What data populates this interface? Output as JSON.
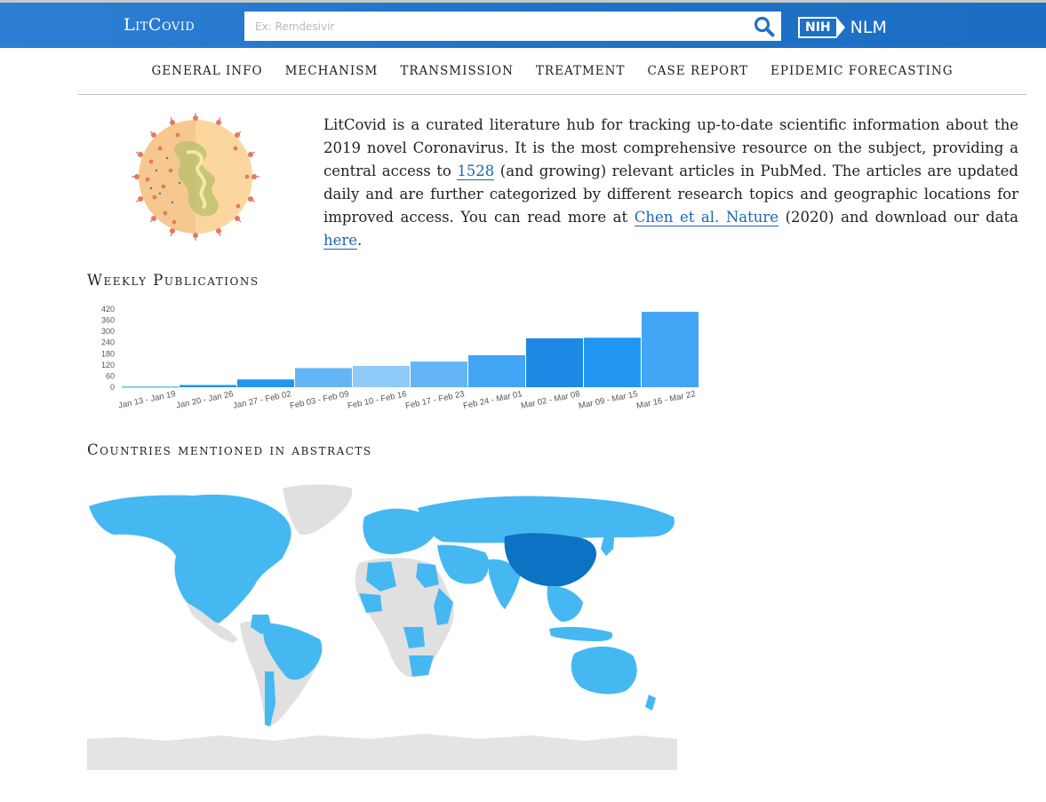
{
  "header": {
    "brand": "LitCovid",
    "search_placeholder": "Ex: Remdesivir",
    "search_icon": "search-icon",
    "nih_label": "NIH",
    "nlm_label": "NLM",
    "colors": {
      "bar": "#1f71c6",
      "accent": "#1a66b5"
    }
  },
  "nav": {
    "items": [
      "GENERAL INFO",
      "MECHANISM",
      "TRANSMISSION",
      "TREATMENT",
      "CASE REPORT",
      "EPIDEMIC FORECASTING"
    ]
  },
  "intro": {
    "text_before_count": "LitCovid is a curated literature hub for tracking up-to-date scientific information about the 2019 novel Coronavirus. It is the most comprehensive resource on the subject, providing a central access to ",
    "count_link": "1528",
    "text_after_count": " (and growing) relevant articles in PubMed. The articles are updated daily and are further categorized by different research topics and geographic locations for improved access. You can read more at ",
    "paper_link": "Chen et al. Nature",
    "text_after_paper": " (2020) and download our data ",
    "data_link": "here",
    "text_end": "."
  },
  "weekly": {
    "title": "Weekly Publications"
  },
  "countries": {
    "title": "Countries mentioned in abstracts",
    "colors": {
      "none": "#e0e0e0",
      "some": "#45b8f2",
      "most": "#0b72c4"
    }
  },
  "chart_data": {
    "type": "bar",
    "title": "Weekly Publications",
    "categories": [
      "Jan 13 - Jan 19",
      "Jan 20 - Jan 26",
      "Jan 27 - Feb 02",
      "Feb 03 - Feb 09",
      "Feb 10 - Feb 16",
      "Feb 17 - Feb 23",
      "Feb 24 - Mar 01",
      "Mar 02 - Mar 08",
      "Mar 09 - Mar 15",
      "Mar 16 - Mar 22"
    ],
    "values": [
      3,
      12,
      42,
      103,
      115,
      138,
      172,
      263,
      266,
      405
    ],
    "colors": [
      "#2196f3",
      "#2196f3",
      "#2196f3",
      "#64b5f6",
      "#90caf9",
      "#64b5f6",
      "#42a5f5",
      "#1e88e5",
      "#2196f3",
      "#42a5f5"
    ],
    "yticks": [
      0,
      60,
      120,
      180,
      240,
      300,
      360,
      420
    ],
    "ylim": [
      0,
      420
    ],
    "xlabel": "",
    "ylabel": "",
    "grid": false
  }
}
